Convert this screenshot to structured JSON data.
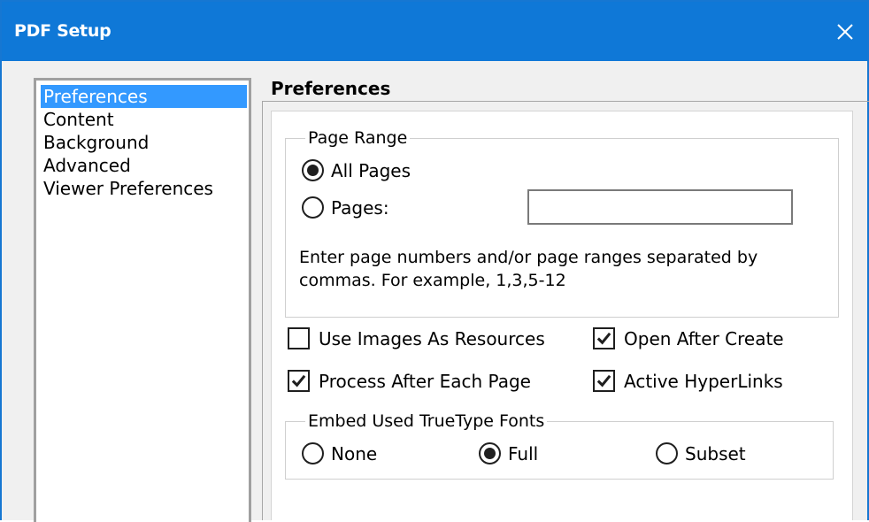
{
  "window": {
    "title": "PDF Setup",
    "close_icon": "close-icon"
  },
  "sidebar": {
    "items": [
      {
        "label": "Preferences",
        "selected": true
      },
      {
        "label": "Content",
        "selected": false
      },
      {
        "label": "Background",
        "selected": false
      },
      {
        "label": "Advanced",
        "selected": false
      },
      {
        "label": "Viewer Preferences",
        "selected": false
      }
    ]
  },
  "panel": {
    "title": "Preferences",
    "page_range": {
      "legend": "Page Range",
      "all_pages_label": "All Pages",
      "all_pages_selected": true,
      "pages_label": "Pages:",
      "pages_selected": false,
      "pages_value": "",
      "helper_text": "Enter page numbers and/or page ranges separated by commas. For example, 1,3,5-12"
    },
    "options": {
      "use_images_label": "Use Images As Resources",
      "use_images_checked": false,
      "open_after_label": "Open After Create",
      "open_after_checked": true,
      "process_after_label": "Process After Each Page",
      "process_after_checked": true,
      "active_links_label": "Active HyperLinks",
      "active_links_checked": true
    },
    "embed_fonts": {
      "legend": "Embed Used TrueType Fonts",
      "none_label": "None",
      "full_label": "Full",
      "subset_label": "Subset",
      "selected": "Full"
    }
  },
  "colors": {
    "titlebar": "#0f78d7",
    "selection": "#3399ff",
    "check": "#1f1f1f"
  }
}
